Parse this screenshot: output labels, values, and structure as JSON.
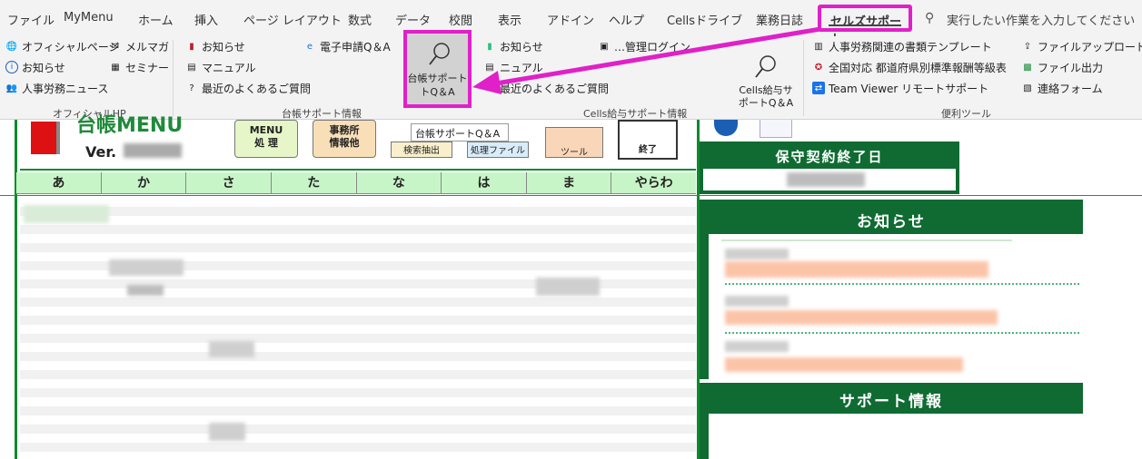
{
  "menu": {
    "items": [
      "ファイル",
      "MyMenu",
      "ホーム",
      "挿入",
      "ページ レイアウト",
      "数式",
      "データ",
      "校閲",
      "表示",
      "アドイン",
      "ヘルプ",
      "Cellsドライブ",
      "業務日誌"
    ],
    "selected": "セルズサポート",
    "search_placeholder": "実行したい作業を入力してください"
  },
  "ribbon": {
    "official": {
      "group_label": "オフィシャルHP",
      "official_page": "オフィシャルページ",
      "mailmag": "メルマガ",
      "news": "お知らせ",
      "seminar": "セミナー",
      "hr_news": "人事労務ニュース"
    },
    "daicho": {
      "group_label": "台帳サポート情報",
      "news": "お知らせ",
      "manual": "マニュアル",
      "faq": "最近のよくあるご質問",
      "egov": "電子申請Q＆A",
      "qa_button": "台帳サポート\nトQ＆A"
    },
    "cells": {
      "group_label": "Cells給与サポート情報",
      "news": "お知らせ",
      "manual": "ニュアル",
      "faq": "最近のよくあるご質問",
      "login": "…管理ログイン",
      "qa_button": "Cells給与サ\nポートQ＆A"
    },
    "tools": {
      "group_label": "便利ツール",
      "template": "人事労務関連の書類テンプレート",
      "salary_table": "全国対応 都道府県別標準報酬等級表",
      "teamviewer": "Team Viewer リモートサポート",
      "upload": "ファイルアップロード",
      "file_output": "ファイル出力",
      "contact": "連絡フォーム"
    },
    "tooltip": "台帳サポートQ＆A"
  },
  "sheet": {
    "logo_partial": "台帳MENU",
    "version": "Ver.",
    "buttons": [
      "MENU\n処 理",
      "事務所\n情報他",
      "検索抽出",
      "処理ファイル",
      "ツール",
      "終了"
    ],
    "kana_headers": [
      "あ",
      "か",
      "さ",
      "た",
      "な",
      "は",
      "ま",
      "やらわ"
    ],
    "maintenance_title": "保守契約終了日",
    "notice_title": "お知らせ",
    "support_title": "サポート情報"
  },
  "colors": {
    "accent_magenta": "#e020c8",
    "sheet_green": "#0f6b32",
    "kana_bg": "#c8f5c8"
  }
}
